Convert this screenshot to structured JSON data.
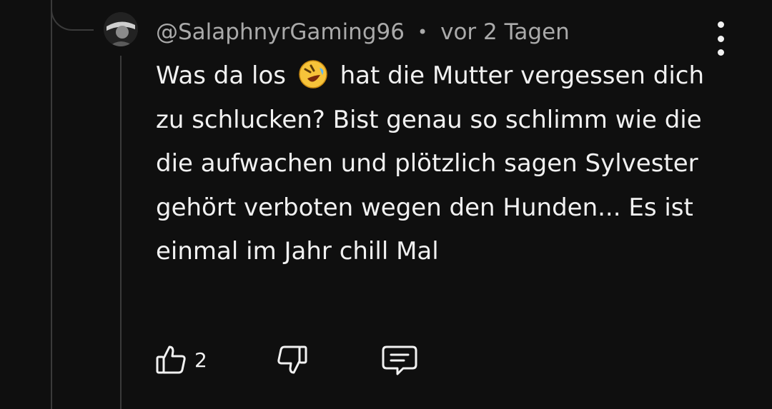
{
  "comment": {
    "author": "@SalaphnyrGaming96",
    "separator": "•",
    "time": "vor 2 Tagen",
    "text_before_emoji": "Was da los",
    "text_after_emoji": "hat die Mutter vergessen dich zu schlucken? Bist genau so schlimm wie die die aufwachen und plötzlich sagen Sylvester gehört verboten wegen den Hunden... Es ist einmal im Jahr chill Mal",
    "emoji": "rolling-on-floor-laughing-emoji",
    "like_count": "2"
  },
  "icons": {
    "like": "thumbs-up-icon",
    "dislike": "thumbs-down-icon",
    "reply": "reply-icon",
    "more": "more-vertical-icon"
  },
  "colors": {
    "background": "#0f0f0f",
    "text": "#f1f1f1",
    "meta": "#aaaaaa",
    "thread_line": "#3a3a3a",
    "emoji": "#f6c33a"
  }
}
